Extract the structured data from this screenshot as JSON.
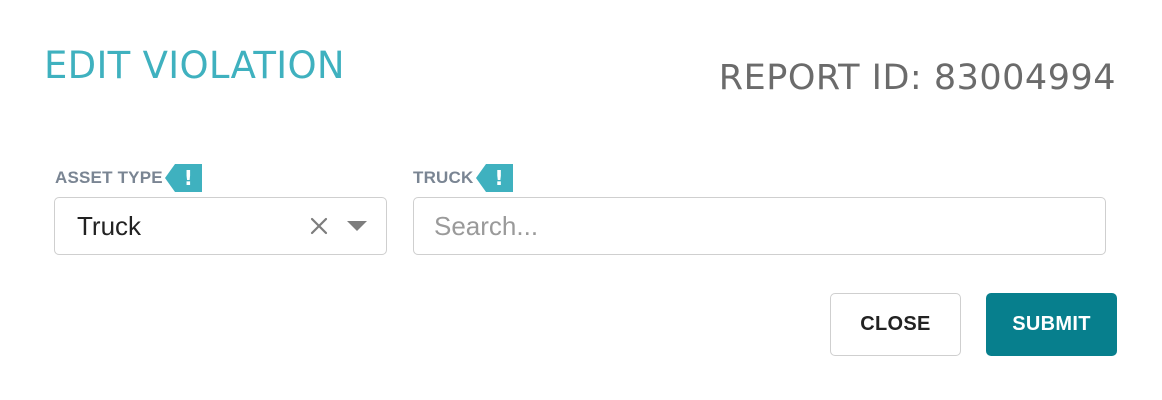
{
  "modal": {
    "title": "EDIT VIOLATION",
    "report_id": "REPORT ID: 83004994"
  },
  "fields": {
    "asset_type": {
      "label": "ASSET TYPE",
      "required_badge": "!",
      "value": "Truck",
      "clear_icon": "close-x-icon",
      "dropdown_icon": "caret-down-icon"
    },
    "truck": {
      "label": "TRUCK",
      "required_badge": "!",
      "placeholder": "Search...",
      "value": ""
    }
  },
  "actions": {
    "close_label": "CLOSE",
    "submit_label": "SUBMIT"
  },
  "colors": {
    "accent": "#3fb1bf",
    "primary_button": "#077f8d",
    "report_id_text": "#6b6b6b",
    "label_text": "#7a8593",
    "border": "#cfcfcf"
  }
}
